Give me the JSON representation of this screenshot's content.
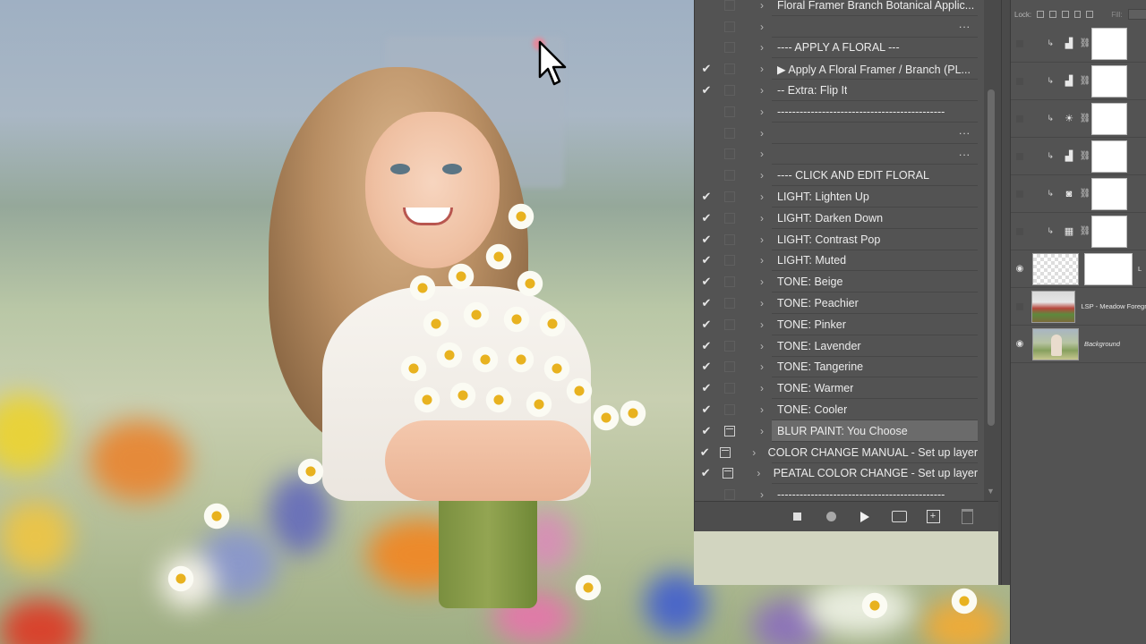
{
  "actions": {
    "rows": [
      {
        "check": "",
        "dialog": "",
        "label": "Floral Framer Branch Botanical Applic...",
        "dots": "",
        "selected": false
      },
      {
        "check": "",
        "dialog": "",
        "label": "",
        "dots": "...",
        "selected": false
      },
      {
        "check": "",
        "dialog": "",
        "label": "---- APPLY A FLORAL ---",
        "dots": "",
        "selected": false
      },
      {
        "check": "✔",
        "dialog": "",
        "label": "▶ Apply A Floral Framer / Branch (PL...",
        "dots": "",
        "selected": false
      },
      {
        "check": "✔",
        "dialog": "",
        "label": "-- Extra: Flip It",
        "dots": "",
        "selected": false
      },
      {
        "check": "",
        "dialog": "",
        "label": "---------------------------------------------",
        "dots": "",
        "selected": false
      },
      {
        "check": "",
        "dialog": "",
        "label": "",
        "dots": "...",
        "selected": false
      },
      {
        "check": "",
        "dialog": "",
        "label": "",
        "dots": "...",
        "selected": false
      },
      {
        "check": "",
        "dialog": "",
        "label": "---- CLICK AND EDIT FLORAL",
        "dots": "",
        "selected": false
      },
      {
        "check": "✔",
        "dialog": "",
        "label": "LIGHT: Lighten Up",
        "dots": "",
        "selected": false
      },
      {
        "check": "✔",
        "dialog": "",
        "label": "LIGHT: Darken Down",
        "dots": "",
        "selected": false
      },
      {
        "check": "✔",
        "dialog": "",
        "label": "LIGHT: Contrast Pop",
        "dots": "",
        "selected": false
      },
      {
        "check": "✔",
        "dialog": "",
        "label": "LIGHT: Muted",
        "dots": "",
        "selected": false
      },
      {
        "check": "✔",
        "dialog": "",
        "label": "TONE: Beige",
        "dots": "",
        "selected": false
      },
      {
        "check": "✔",
        "dialog": "",
        "label": "TONE: Peachier",
        "dots": "",
        "selected": false
      },
      {
        "check": "✔",
        "dialog": "",
        "label": "TONE: Pinker",
        "dots": "",
        "selected": false
      },
      {
        "check": "✔",
        "dialog": "",
        "label": "TONE: Lavender",
        "dots": "",
        "selected": false
      },
      {
        "check": "✔",
        "dialog": "",
        "label": "TONE: Tangerine",
        "dots": "",
        "selected": false
      },
      {
        "check": "✔",
        "dialog": "",
        "label": "TONE: Warmer",
        "dots": "",
        "selected": false
      },
      {
        "check": "✔",
        "dialog": "",
        "label": "TONE: Cooler",
        "dots": "",
        "selected": false
      },
      {
        "check": "✔",
        "dialog": "dialog",
        "label": "BLUR PAINT: You Choose",
        "dots": "",
        "selected": true
      },
      {
        "check": "✔",
        "dialog": "dialog",
        "label": "COLOR CHANGE MANUAL - Set up layer",
        "dots": "",
        "selected": false
      },
      {
        "check": "✔",
        "dialog": "dialog",
        "label": "PEATAL COLOR CHANGE  - Set up layer",
        "dots": "",
        "selected": false
      },
      {
        "check": "",
        "dialog": "",
        "label": "---------------------------------------------",
        "dots": "",
        "selected": false
      }
    ]
  },
  "layers": {
    "lock_label": "Lock:",
    "fill_label": "Fill:",
    "fill_value": "100%",
    "items": [
      {
        "eye": false,
        "type": "adjustment",
        "icon": "levels-icon",
        "glyph": "▟",
        "name": ""
      },
      {
        "eye": false,
        "type": "adjustment",
        "icon": "levels-icon",
        "glyph": "▟",
        "name": ""
      },
      {
        "eye": false,
        "type": "adjustment",
        "icon": "brightness-icon",
        "glyph": "☀",
        "name": ""
      },
      {
        "eye": false,
        "type": "adjustment",
        "icon": "levels-icon",
        "glyph": "▟",
        "name": ""
      },
      {
        "eye": false,
        "type": "adjustment",
        "icon": "camera-icon",
        "glyph": "◙",
        "name": ""
      },
      {
        "eye": false,
        "type": "adjustment",
        "icon": "channel-mixer-icon",
        "glyph": "▦",
        "name": ""
      },
      {
        "eye": true,
        "type": "smart",
        "name": "L"
      },
      {
        "eye": false,
        "type": "image",
        "name": "LSP - Meadow Foregro"
      },
      {
        "eye": true,
        "type": "background",
        "name": "Background"
      }
    ]
  },
  "colors": {
    "panel_bg": "#535353",
    "selected_row": "#6b6b6b",
    "text": "#ececec"
  }
}
